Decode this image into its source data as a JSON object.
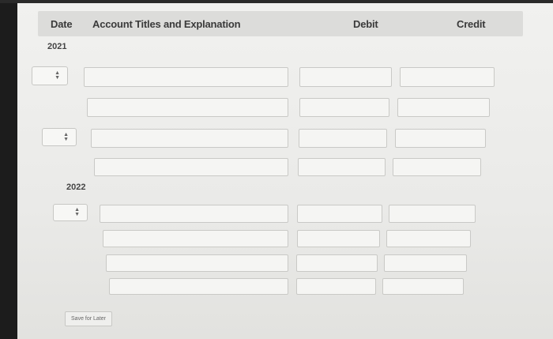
{
  "header": {
    "date": "Date",
    "account": "Account Titles and Explanation",
    "debit": "Debit",
    "credit": "Credit"
  },
  "years": [
    "2021",
    "2022"
  ],
  "select_icon": "up-down-arrows-icon",
  "save_label": "Save for Later"
}
